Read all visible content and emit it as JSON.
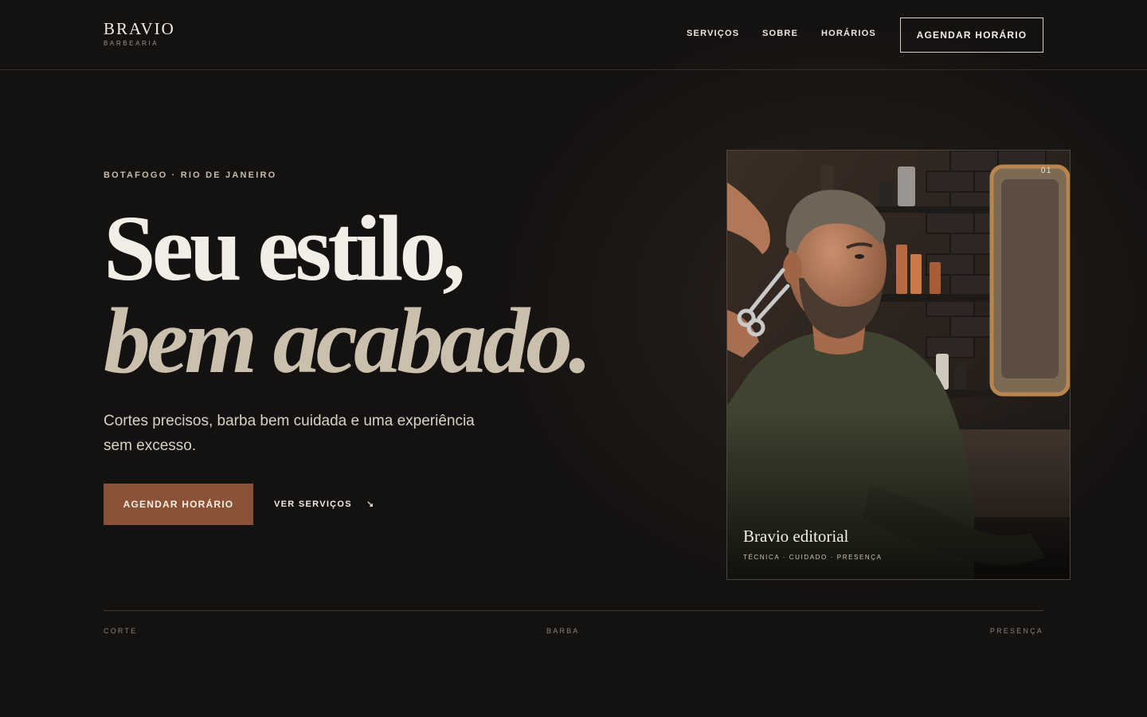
{
  "brand": {
    "name": "BRAVIO",
    "tagline": "BARBEARIA"
  },
  "nav": {
    "items": [
      "SERVIÇOS",
      "SOBRE",
      "HORÁRIOS"
    ],
    "cta": "AGENDAR HORÁRIO"
  },
  "hero": {
    "eyebrow": "BOTAFOGO · RIO DE JANEIRO",
    "title_line1": "Seu estilo,",
    "title_line2": "bem acabado.",
    "lead": "Cortes precisos, barba bem cuidada e uma experiência sem excesso.",
    "primary_cta": "AGENDAR HORÁRIO",
    "secondary_cta": "VER SERVIÇOS",
    "secondary_arrow": "↘"
  },
  "card": {
    "index": "01",
    "title": "Bravio editorial",
    "tags": "TÉCNICA · CUIDADO · PRESENÇA"
  },
  "strip": [
    "CORTE",
    "BARBA",
    "PRESENÇA"
  ],
  "colors": {
    "background": "#141211",
    "accent": "#8a5337",
    "text": "#f1ede6",
    "muted": "#cbbfad"
  }
}
